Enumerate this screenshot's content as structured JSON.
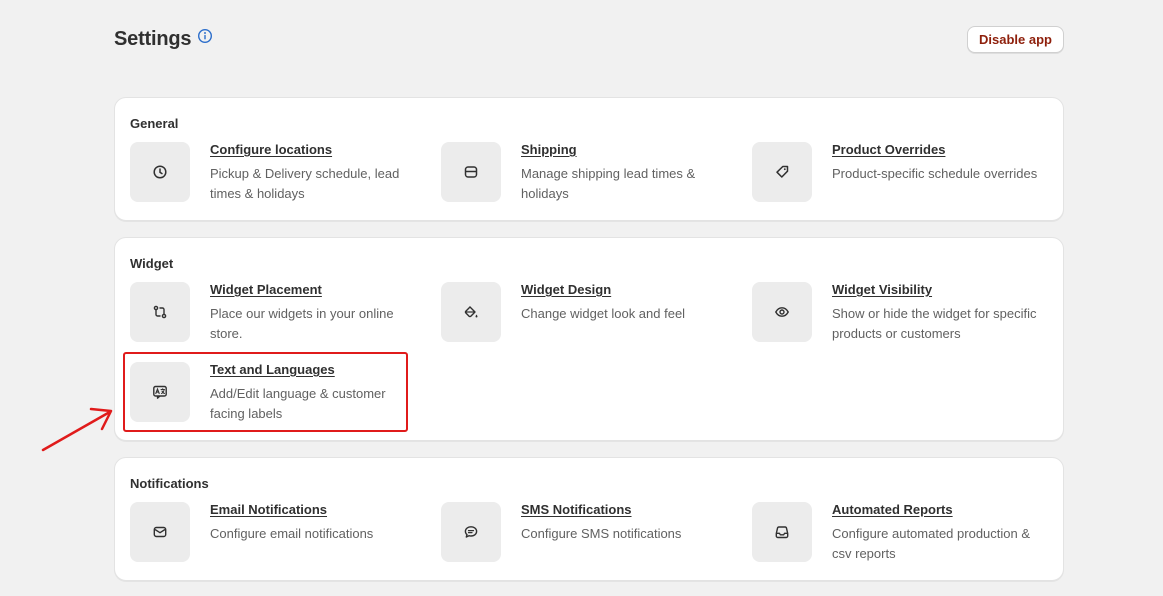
{
  "header": {
    "title": "Settings",
    "disable_label": "Disable app"
  },
  "sections": {
    "general": {
      "title": "General",
      "items": [
        {
          "title": "Configure locations",
          "desc": "Pickup & Delivery schedule, lead times & holidays",
          "icon": "clock-icon"
        },
        {
          "title": "Shipping",
          "desc": "Manage shipping lead times & holidays",
          "icon": "box-icon"
        },
        {
          "title": "Product Overrides",
          "desc": "Product-specific schedule overrides",
          "icon": "tag-icon"
        }
      ]
    },
    "widget": {
      "title": "Widget",
      "items": [
        {
          "title": "Widget Placement",
          "desc": "Place our widgets in your online store.",
          "icon": "arrows-swap-icon"
        },
        {
          "title": "Widget Design",
          "desc": "Change widget look and feel",
          "icon": "paint-bucket-icon"
        },
        {
          "title": "Widget Visibility",
          "desc": "Show or hide the widget for specific products or customers",
          "icon": "eye-icon"
        },
        {
          "title": "Text and Languages",
          "desc": "Add/Edit language & customer facing labels",
          "icon": "language-icon"
        }
      ]
    },
    "notifications": {
      "title": "Notifications",
      "items": [
        {
          "title": "Email Notifications",
          "desc": "Configure email notifications",
          "icon": "envelope-icon"
        },
        {
          "title": "SMS Notifications",
          "desc": "Configure SMS notifications",
          "icon": "chat-bubble-icon"
        },
        {
          "title": "Automated Reports",
          "desc": "Configure automated production & csv reports",
          "icon": "inbox-icon"
        }
      ]
    }
  },
  "colors": {
    "background": "#f1f1f1",
    "card": "#ffffff",
    "icon_tile": "#ececec",
    "disable_text": "#8e1f0b",
    "info_icon": "#2c6ecb",
    "annotation": "#e01b1b"
  }
}
